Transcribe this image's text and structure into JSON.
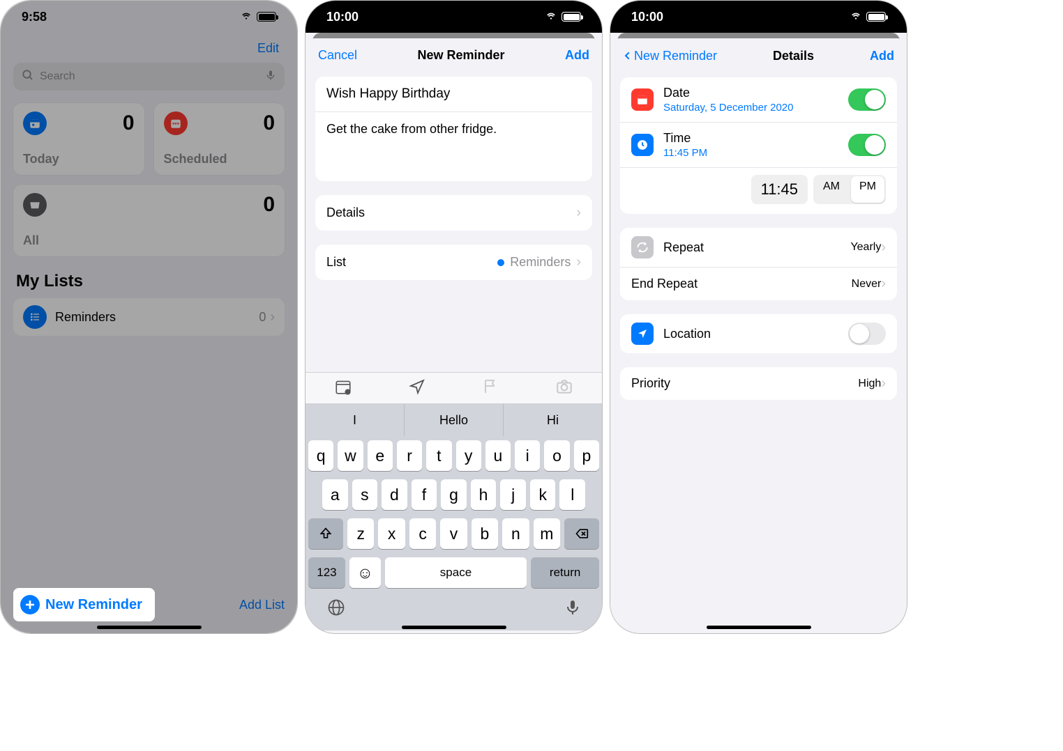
{
  "screen1": {
    "time": "9:58",
    "edit": "Edit",
    "search_placeholder": "Search",
    "cards": {
      "today": {
        "label": "Today",
        "count": "0"
      },
      "scheduled": {
        "label": "Scheduled",
        "count": "0"
      },
      "all": {
        "label": "All",
        "count": "0"
      }
    },
    "my_lists": "My Lists",
    "list": {
      "name": "Reminders",
      "count": "0"
    },
    "new_reminder": "New Reminder",
    "add_list": "Add List"
  },
  "screen2": {
    "time": "10:00",
    "cancel": "Cancel",
    "title": "New Reminder",
    "add": "Add",
    "reminder_title": "Wish Happy Birthday",
    "reminder_notes": "Get the cake from other fridge.",
    "details": "Details",
    "list_label": "List",
    "list_value": "Reminders",
    "suggest": [
      "I",
      "Hello",
      "Hi"
    ],
    "keys_r1": [
      "q",
      "w",
      "e",
      "r",
      "t",
      "y",
      "u",
      "i",
      "o",
      "p"
    ],
    "keys_r2": [
      "a",
      "s",
      "d",
      "f",
      "g",
      "h",
      "j",
      "k",
      "l"
    ],
    "keys_r3": [
      "z",
      "x",
      "c",
      "v",
      "b",
      "n",
      "m"
    ],
    "num_key": "123",
    "space": "space",
    "return": "return"
  },
  "screen3": {
    "time": "10:00",
    "back": "New Reminder",
    "title": "Details",
    "add": "Add",
    "date_label": "Date",
    "date_value": "Saturday, 5 December 2020",
    "time_label": "Time",
    "time_value": "11:45 PM",
    "picker_time": "11:45",
    "am": "AM",
    "pm": "PM",
    "repeat": "Repeat",
    "repeat_value": "Yearly",
    "end_repeat": "End Repeat",
    "end_repeat_value": "Never",
    "location": "Location",
    "priority": "Priority",
    "priority_value": "High"
  }
}
